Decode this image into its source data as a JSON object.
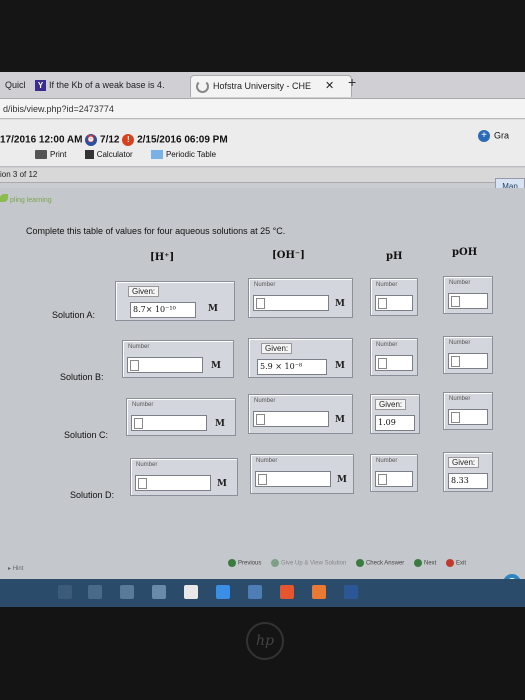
{
  "browser": {
    "tabs": [
      {
        "label": "Quicl"
      },
      {
        "label": "If the Kb of a weak base is 4."
      },
      {
        "label": "Hofstra University - CHE"
      }
    ],
    "close_glyph": "✕",
    "newtab_glyph": "+",
    "url": "d/ibis/view.php?id=2473774"
  },
  "header": {
    "start_date": "17/2016 12:00 AM",
    "alarm_date": "7/12",
    "due_date": "2/15/2016 06:09 PM",
    "grades_label": "Gra",
    "tools": {
      "print": "Print",
      "calculator": "Calculator",
      "periodic_table": "Periodic Table"
    }
  },
  "question_nav": {
    "label": "ion 3 of 12",
    "map": "Map"
  },
  "brand": {
    "text": "pling learning"
  },
  "instruction": "Complete this table of values for four aqueous solutions at 25 °C.",
  "table": {
    "columns": {
      "h": "[H⁺]",
      "oh": "[OH⁻]",
      "ph": "pH",
      "poh": "pOH"
    },
    "number_label": "Number",
    "given_label": "Given:",
    "unit": "M",
    "rows": [
      {
        "label": "Solution A:",
        "given_value": "8.7× 10⁻¹⁰"
      },
      {
        "label": "Solution B:",
        "given_value": "5.9 × 10⁻⁸"
      },
      {
        "label": "Solution C:",
        "given_value": "1.09"
      },
      {
        "label": "Solution D:",
        "given_value": "8.33"
      }
    ]
  },
  "footer": {
    "previous": "Previous",
    "give_up": "Give Up & View Solution",
    "check": "Check Answer",
    "next": "Next",
    "exit": "Exit",
    "hint": "Hint"
  },
  "colors": {
    "taskbar": "#2b4b6b",
    "accent": "#2a4fa0",
    "late": "#d9401d"
  }
}
